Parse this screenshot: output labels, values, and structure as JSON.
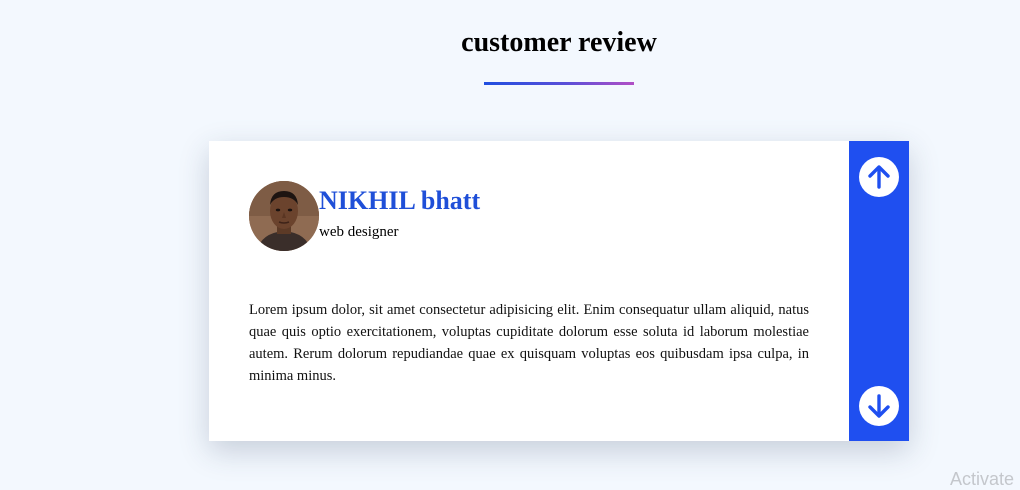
{
  "section": {
    "title": "customer review"
  },
  "review": {
    "name": "NIKHIL bhatt",
    "role": "web designer",
    "text": "Lorem ipsum dolor, sit amet consectetur adipisicing elit. Enim consequatur ullam aliquid, natus quae quis optio exercitationem, voluptas cupiditate dolorum esse soluta id laborum molestiae autem. Rerum dolorum repudiandae quae ex quisquam voluptas eos quibusdam ipsa culpa, in minima minus."
  },
  "nav": {
    "up_icon": "arrow-up-icon",
    "down_icon": "arrow-down-icon"
  },
  "colors": {
    "accent": "#1f4ff0",
    "name": "#1f4fd8",
    "background": "#f3f8fe"
  },
  "watermark": {
    "text": "Activate"
  }
}
